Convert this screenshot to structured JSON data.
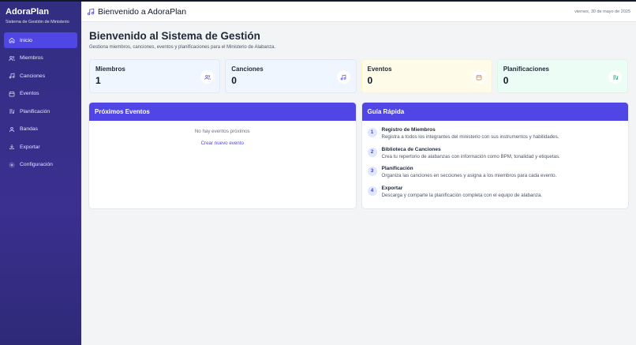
{
  "sidebar": {
    "app_name": "AdoraPlan",
    "app_subtitle": "Sistema de Gestión de Ministerio",
    "items": [
      {
        "label": "Inicio",
        "icon": "home-icon",
        "active": true
      },
      {
        "label": "Miembros",
        "icon": "users-icon"
      },
      {
        "label": "Canciones",
        "icon": "music-note-icon"
      },
      {
        "label": "Eventos",
        "icon": "calendar-icon"
      },
      {
        "label": "Planificación",
        "icon": "list-music-icon"
      },
      {
        "label": "Bandas",
        "icon": "band-icon"
      },
      {
        "label": "Exportar",
        "icon": "download-icon"
      },
      {
        "label": "Configuración",
        "icon": "gear-icon"
      }
    ]
  },
  "header": {
    "title": "Bienvenido a AdoraPlan",
    "date": "viernes, 30 de mayo de 2025",
    "icon": "music-note-icon"
  },
  "page": {
    "title": "Bienvenido al Sistema de Gestión",
    "subtitle": "Gestiona miembros, canciones, eventos y planificaciones para el Ministerio de Alabanza."
  },
  "stats": [
    {
      "label": "Miembros",
      "value": "1",
      "icon": "users-icon",
      "color": "#4f46e5"
    },
    {
      "label": "Canciones",
      "value": "0",
      "icon": "music-note-icon",
      "color": "#4f46e5"
    },
    {
      "label": "Eventos",
      "value": "0",
      "icon": "calendar-icon",
      "color": "#d97706"
    },
    {
      "label": "Planificaciones",
      "value": "0",
      "icon": "list-music-icon",
      "color": "#059669"
    }
  ],
  "events_panel": {
    "title": "Próximos Eventos",
    "empty_text": "No hay eventos próximos",
    "create_link": "Crear nuevo evento"
  },
  "guide_panel": {
    "title": "Guía Rápida",
    "items": [
      {
        "num": "1",
        "title": "Registro de Miembros",
        "desc": "Registra a todos los integrantes del ministerio con sus instrumentos y habilidades."
      },
      {
        "num": "2",
        "title": "Biblioteca de Canciones",
        "desc": "Crea tu repertorio de alabanzas con información como BPM, tonalidad y etiquetas."
      },
      {
        "num": "3",
        "title": "Planificación",
        "desc": "Organiza las canciones en secciones y asigna a los miembros para cada evento."
      },
      {
        "num": "4",
        "title": "Exportar",
        "desc": "Descarga y comparte la planificación completa con el equipo de alabanza."
      }
    ]
  },
  "colors": {
    "sidebar": "#312e81",
    "accent": "#4f46e5",
    "background": "#f3f4f6"
  }
}
